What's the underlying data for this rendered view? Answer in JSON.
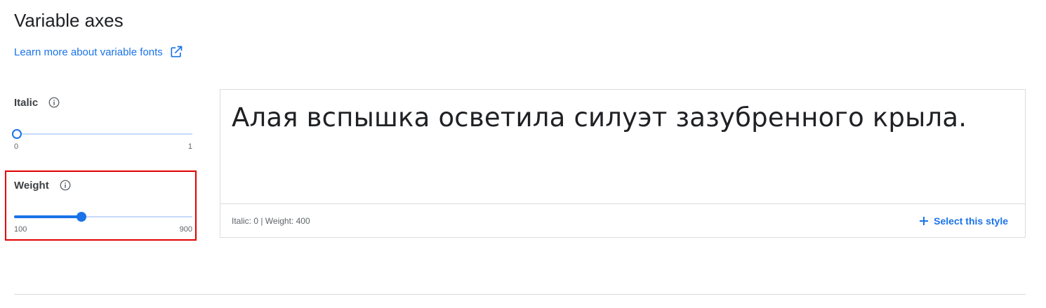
{
  "section": {
    "title": "Variable axes",
    "learn_more_label": "Learn more about variable fonts"
  },
  "axes": {
    "italic": {
      "label": "Italic",
      "min_label": "0",
      "max_label": "1",
      "value": 0,
      "min": 0,
      "max": 1
    },
    "weight": {
      "label": "Weight",
      "min_label": "100",
      "max_label": "900",
      "value": 400,
      "min": 100,
      "max": 900
    }
  },
  "preview": {
    "sample_text": "Алая вспышка осветила силуэт зазубренного крыла.",
    "style_info": "Italic: 0 | Weight: 400",
    "select_label": "Select this style"
  },
  "colors": {
    "accent": "#1a73e8",
    "highlight": "#e00000"
  },
  "icons": {
    "external_link": "open-in-new-icon",
    "info": "info-icon",
    "plus": "plus-icon"
  }
}
